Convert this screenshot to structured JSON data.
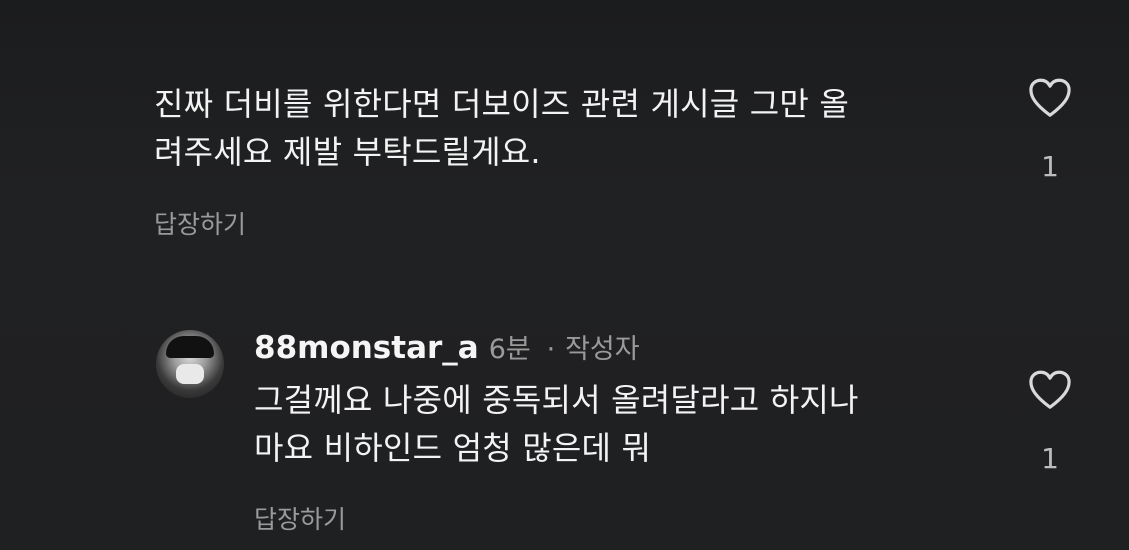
{
  "comments": [
    {
      "lines": [
        "진짜 더비를 위한다면 더보이즈 관련 게시글 그만 올",
        "려주세요 제발 부탁드릴게요."
      ],
      "reply_label": "답장하기",
      "like_count": "1",
      "like_icon": "heart-outline-icon"
    }
  ],
  "reply": {
    "username": "88monstar_a",
    "time": "6분",
    "separator": "·",
    "author_tag": "작성자",
    "lines": [
      "그걸께요 나중에 중독되서 올려달라고 하지나",
      "마요 비하인드 엄청 많은데 뭐"
    ],
    "reply_label": "답장하기",
    "like_count": "1",
    "like_icon": "heart-outline-icon",
    "avatar_icon": "profile-avatar"
  },
  "colors": {
    "background": "#1f2022",
    "primary_text": "#f3f3f3",
    "secondary_text": "#9a9a9a"
  }
}
